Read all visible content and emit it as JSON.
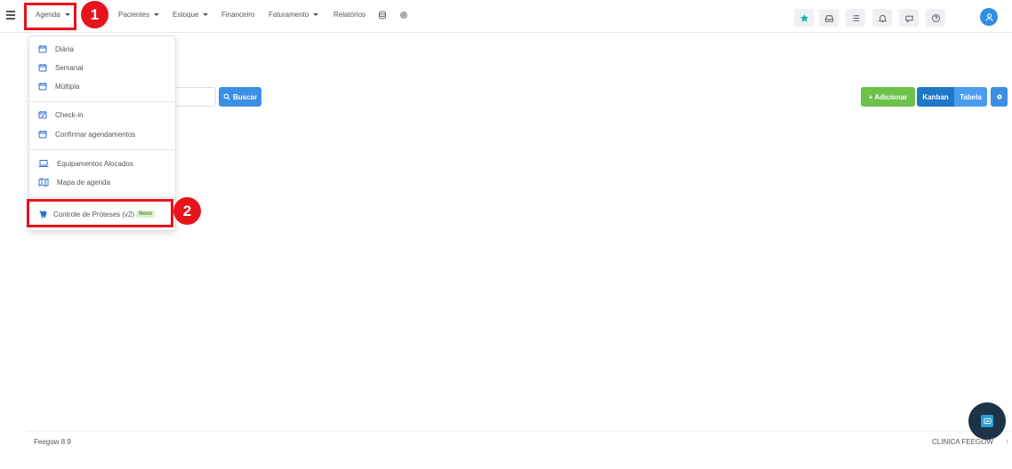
{
  "nav": {
    "agenda": "Agenda",
    "pacientes": "Pacientes",
    "estoque": "Estoque",
    "financeiro": "Financeiro",
    "faturamento": "Faturamento",
    "relatorios": "Relatórios"
  },
  "annotations": {
    "one": "1",
    "two": "2"
  },
  "dropdown": {
    "diaria": "Diária",
    "semanal": "Semanal",
    "multipla": "Múltipla",
    "checkin": "Check-in",
    "confirmar": "Confirmar agendamentos",
    "equipamentos": "Equipamentos Alocados",
    "mapa": "Mapa de agenda",
    "proteses": "Controle de Próteses (v2)",
    "novo_badge": "Novo"
  },
  "toolbar": {
    "buscar": "Buscar",
    "adicionar": "Adicionar",
    "kanban": "Kanban",
    "tabela": "Tabela"
  },
  "footer": {
    "version": "Feegow 8.9",
    "clinic": "CLINICA FEEGOW"
  },
  "colors": {
    "highlight": "#e8141b",
    "primary": "#3d8fe5",
    "success": "#6cc24a",
    "kanban_active": "#1f77c9",
    "star": "#19b9a6"
  },
  "icons": [
    "hamburger-icon",
    "caret-down-icon",
    "database-icon",
    "gear-icon",
    "star-icon",
    "inbox-icon",
    "list-icon",
    "bell-icon",
    "chat-icon",
    "help-icon",
    "user-icon",
    "calendar-icon",
    "laptop-icon",
    "map-icon",
    "tooth-icon",
    "search-icon",
    "plus-icon"
  ]
}
